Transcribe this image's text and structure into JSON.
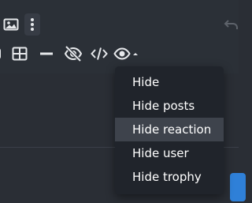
{
  "toolbar": {
    "icons": [
      "image-icon",
      "more-vertical-icon",
      "undo-icon",
      "table-icon",
      "horizontal-rule-icon",
      "hide-icon",
      "code-icon",
      "eye-dropdown-icon"
    ]
  },
  "menu": {
    "items": [
      {
        "label": "Hide"
      },
      {
        "label": "Hide posts"
      },
      {
        "label": "Hide reaction",
        "highlighted": true
      },
      {
        "label": "Hide user"
      },
      {
        "label": "Hide trophy"
      }
    ]
  },
  "colors": {
    "background": "#2a2e35",
    "menu_background": "#20242b",
    "menu_highlight": "#3e434c",
    "accent_blue": "#2f80d8",
    "icon": "#e6e8eb"
  }
}
